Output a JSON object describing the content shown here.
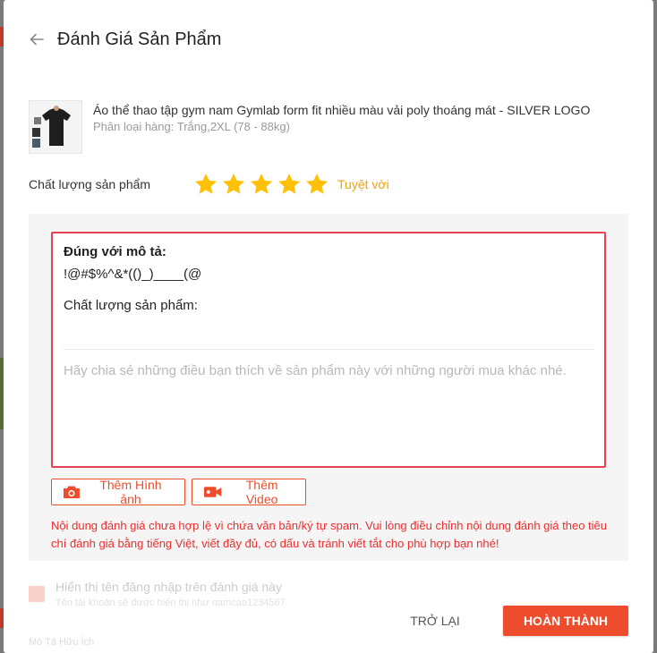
{
  "modal": {
    "title": "Đánh Giá Sản Phẩm"
  },
  "product": {
    "name": "Áo thể thao tập gym nam Gymlab form fit nhiều màu vải poly thoáng mát - SILVER LOGO",
    "variant": "Phân loại hàng: Trắng,2XL (78 - 88kg)"
  },
  "rating": {
    "label": "Chất lượng sản phẩm",
    "stars": 5,
    "max_stars": 5,
    "text": "Tuyệt vời",
    "star_color": "#ffc107"
  },
  "review": {
    "heading": "Đúng với mô tả:",
    "content": "!@#$%^&*(()_)____(@",
    "quality_label": "Chất lượng sản phẩm:",
    "placeholder": "Hãy chia sẻ những điều bạn thích về sản phẩm này với những người mua khác nhé."
  },
  "media_buttons": {
    "add_image": "Thêm Hình ảnh",
    "add_video": "Thêm Video"
  },
  "warning": "Nội dung đánh giá chưa hợp lệ vì chứa văn bản/ký tự spam. Vui lòng điều chỉnh nội dung đánh giá theo tiêu chí đánh giá bằng tiếng Việt, viết đầy đủ, có dấu và tránh viết tắt cho phù hợp bạn nhé!",
  "username_option": {
    "label": "Hiển thị tên đăng nhập trên đánh giá này",
    "sublabel": "Tên tài khoản sẽ được hiển thị như namcao1234567"
  },
  "faded_bottom": "Mô Tả Hữu Ích",
  "footer": {
    "back_label": "TRỞ LẠI",
    "done_label": "HOÀN THÀNH"
  },
  "colors": {
    "accent": "#ee4d2d",
    "error": "#e84152",
    "star": "#ffc107"
  }
}
